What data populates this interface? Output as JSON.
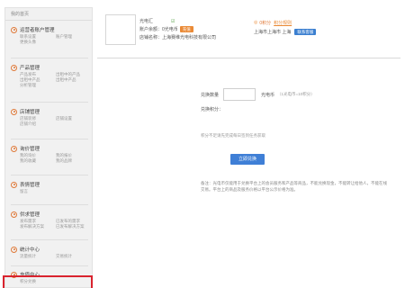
{
  "sidebar": {
    "header": "我的首页",
    "groups": [
      {
        "title": "运营者账户管理",
        "items": [
          "联系设置",
          "账户管理",
          "更换头像"
        ]
      },
      {
        "title": "产品管理",
        "items": [
          "产品发布",
          "出租中的产品",
          "出租中产品",
          "出租中产品",
          "分析管理"
        ]
      },
      {
        "title": "店铺管理",
        "items": [
          "店铺装修",
          "店铺设置",
          "店铺介绍"
        ]
      },
      {
        "title": "询价管理",
        "items": [
          "我的询价",
          "我的报价",
          "我的收藏",
          "我的品牌"
        ]
      },
      {
        "title": "表情管理",
        "items": [
          "留言"
        ]
      },
      {
        "title": "供求管理",
        "items": [
          "发布需求",
          "已发布的需求",
          "发布解决方案",
          "已发布解决方案"
        ]
      },
      {
        "title": "统计中心",
        "items": [
          "流量统计",
          "交易统计"
        ]
      },
      {
        "title": "充值中心",
        "items": [
          "积分兑换"
        ]
      }
    ]
  },
  "account": {
    "name": "光电汇",
    "balance_label": "账户余额：",
    "balance_value": "0光电币",
    "recharge_button": "充值",
    "company_label": "店铺名称：",
    "company_value": "上海赛维光电科技有限公司",
    "level_label": "0积分",
    "level_link": "积分规则",
    "location": "上海市上海市 上海",
    "status_button": "联系客服"
  },
  "form": {
    "quantity_label": "兑换数量",
    "quantity_value": "",
    "unit_text": "光电币",
    "unit_note": "（1光电币=10积分）",
    "points_label": "兑换积分：",
    "warning_text": "积分不足请先完成每日签到任务获取",
    "submit_button": "立即兑换"
  },
  "note": {
    "text": "备注：光电币仅能用于兑换平台上的会员服务和产品等商品，不能兑换现金，不能转让给他人，不能在线交易。平台上的商品及服务价格以平台公示价格为准。"
  },
  "colors": {
    "accent_orange": "#ea8a36",
    "accent_blue": "#3f7fd6",
    "highlight_red": "#d9232e"
  }
}
